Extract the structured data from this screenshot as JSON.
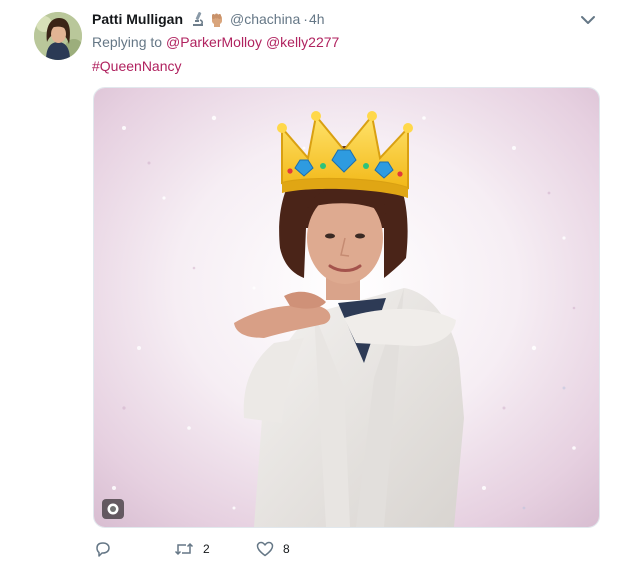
{
  "tweet": {
    "author_name": "Patti Mulligan",
    "handle": "@chachina",
    "separator": "·",
    "time": "4h",
    "badges": [
      "microscope-icon",
      "raised-fist-icon"
    ],
    "replying_prefix": "Replying to",
    "mentions": [
      "@ParkerMolloy",
      "@kelly2277"
    ],
    "hashtag": "#QueenNancy",
    "media_type": "gif"
  },
  "actions": {
    "reply_count": "",
    "retweet_count": "2",
    "like_count": "8"
  },
  "colors": {
    "link": "#b0225f",
    "secondary_text": "#657786",
    "primary_text": "#14171a",
    "icon": "#657786"
  }
}
